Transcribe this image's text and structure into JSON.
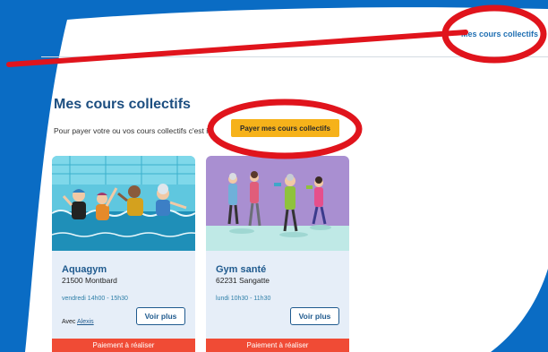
{
  "header": {
    "link_label": "Mes cours collectifs"
  },
  "main": {
    "title": "Mes cours collectifs",
    "intro_text": "Pour payer votre ou vos cours collectifs c'est ici",
    "pay_button_label": "Payer mes cours collectifs"
  },
  "courses": [
    {
      "title": "Aquagym",
      "location": "21500 Montbard",
      "schedule": "vendredi 14h00 - 15h30",
      "coach_prefix": "Avec",
      "coach_name": "Alexis",
      "more_label": "Voir plus",
      "status": "Paiement à réaliser"
    },
    {
      "title": "Gym santé",
      "location": "62231 Sangatte",
      "schedule": "lundi 10h30 - 11h30",
      "more_label": "Voir plus",
      "status": "Paiement à réaliser"
    }
  ],
  "colors": {
    "brand_blue": "#0a6cc4",
    "title_blue": "#1c4e80",
    "pay_button": "#f6b21a",
    "status_red": "#f04b35",
    "annotation_red": "#e0141c"
  }
}
